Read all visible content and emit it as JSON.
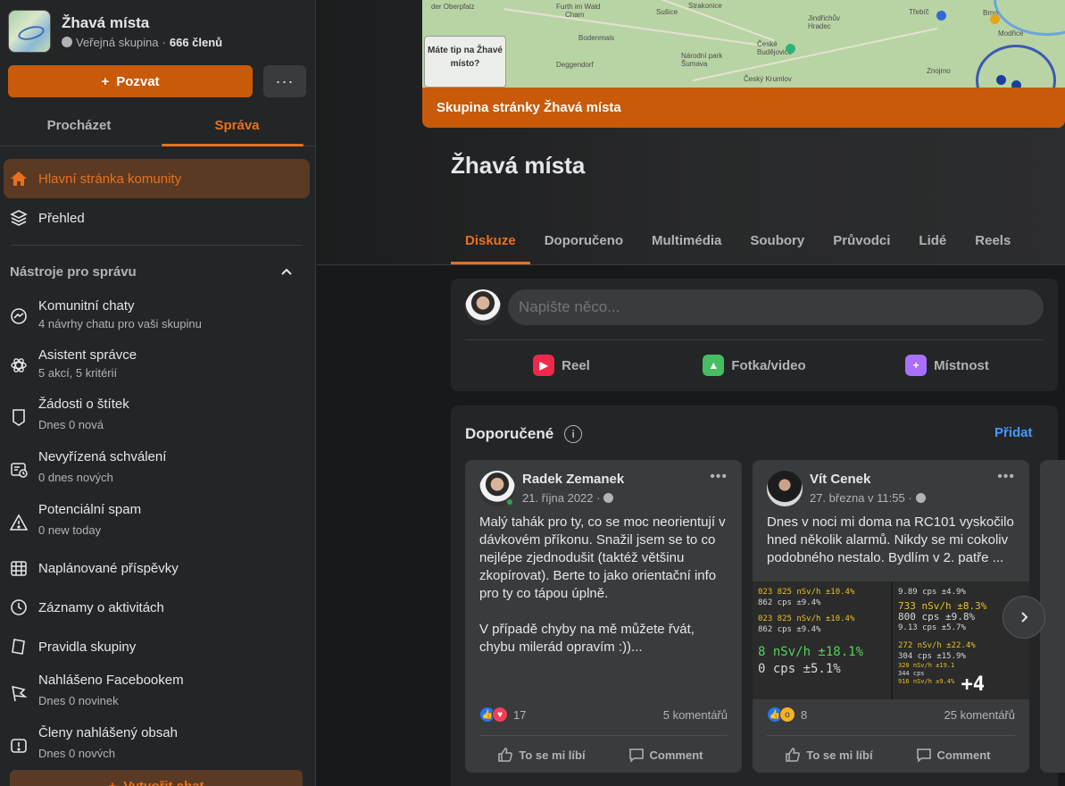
{
  "sidebar": {
    "group_title": "Žhavá místa",
    "group_privacy": "Veřejná skupina",
    "group_members": "666 členů",
    "invite_label": "Pozvat",
    "more_label": "···",
    "tabs": [
      {
        "label": "Procházet"
      },
      {
        "label": "Správa"
      }
    ],
    "items": [
      {
        "label": "Hlavní stránka komunity",
        "icon": "home-icon"
      },
      {
        "label": "Přehled",
        "icon": "layers-icon"
      }
    ],
    "tools_title": "Nástroje pro správu",
    "tools": [
      {
        "label": "Komunitní chaty",
        "sub": "4 návrhy chatu pro vaši skupinu",
        "icon": "messenger-icon"
      },
      {
        "label": "Asistent správce",
        "sub": "5 akcí, 5 kritérií",
        "icon": "atom-icon"
      },
      {
        "label": "Žádosti o štítek",
        "sub": "Dnes 0 nová",
        "icon": "tag-icon"
      },
      {
        "label": "Nevyřízená schválení",
        "sub": "0 dnes nových",
        "icon": "pending-icon"
      },
      {
        "label": "Potenciální spam",
        "sub": "0 new today",
        "icon": "warning-icon"
      },
      {
        "label": "Naplánované příspěvky",
        "sub": "",
        "icon": "calendar-icon"
      },
      {
        "label": "Záznamy o aktivitách",
        "sub": "",
        "icon": "clock-icon"
      },
      {
        "label": "Pravidla skupiny",
        "sub": "",
        "icon": "rules-icon"
      },
      {
        "label": "Nahlášeno Facebookem",
        "sub": "Dnes 0 novinek",
        "icon": "flag-icon"
      },
      {
        "label": "Členy nahlášený obsah",
        "sub": "Dnes 0 nových",
        "icon": "report-icon"
      }
    ],
    "create_chat_label": "Vytvořit chat"
  },
  "cover": {
    "tip_text": "Máte tip na Žhavé místo?",
    "bar_text": "Skupina stránky Žhavá místa",
    "map_places": [
      "Furth im Wald",
      "Cham",
      "Bodenmais",
      "Deggendorf",
      "České Budějovice",
      "Národní park Šumava",
      "Strakonice",
      "Sušice",
      "Jindřichův Hradec",
      "Třebíč",
      "Brno",
      "Modřice",
      "Znojmo",
      "Český Krumlov",
      "der Oberpfalz"
    ]
  },
  "main": {
    "group_name": "Žhavá místa",
    "tabs": [
      {
        "label": "Diskuze"
      },
      {
        "label": "Doporučeno"
      },
      {
        "label": "Multimédia"
      },
      {
        "label": "Soubory"
      },
      {
        "label": "Průvodci"
      },
      {
        "label": "Lidé"
      },
      {
        "label": "Reels"
      }
    ]
  },
  "composer": {
    "placeholder": "Napište něco...",
    "actions": [
      {
        "label": "Reel",
        "color": "#f0284a"
      },
      {
        "label": "Fotka/video",
        "color": "#45bd62"
      },
      {
        "label": "Místnost",
        "color": "#a970ff"
      }
    ]
  },
  "featured": {
    "title": "Doporučené",
    "add_label": "Přidat",
    "posts": [
      {
        "author": "Radek Zemanek",
        "date": "21. října 2022 ·",
        "text": "Malý tahák pro ty, co se moc neorientují v dávkovém příkonu. Snažil jsem se to co nejlépe zjednodušit (taktéž většinu zkopírovat). Berte to jako orientační info pro ty co tápou úplně.\n\nV případě chyby na mě můžete řvát, chybu milerád opravím :))...",
        "reactions": "17",
        "comments": "5 komentářů",
        "like_label": "To se mi líbí",
        "comment_label": "Comment"
      },
      {
        "author": "Vít Cenek",
        "date": "27. března v 11:55 ·",
        "text": "Dnes v noci mi doma na RC101 vyskočilo hned několik alarmů. Nikdy se mi cokoliv podobného nestalo. Bydlím v 2. patře ...",
        "reactions": "8",
        "comments": "25 komentářů",
        "like_label": "To se mi líbí",
        "comment_label": "Comment",
        "media": {
          "left": [
            "023 825 nSv/h ±10.4%",
            "862 cps ±9.4%",
            "023 825 nSv/h ±10.4%",
            "862 cps ±9.4%",
            "8 nSv/h ±18.1%",
            "0 cps ±5.1%"
          ],
          "right": [
            "9.89 cps ±4.9%",
            "733 nSv/h ±8.3%",
            "800 cps ±9.8%",
            "9.13 cps ±5.7%",
            "272 nSv/h ±22.4%",
            "304 cps ±15.9%",
            "320 nSv/h ±19.1",
            "344 cps",
            "916 nSv/h ±9.4%"
          ],
          "more": "+4"
        }
      }
    ]
  }
}
